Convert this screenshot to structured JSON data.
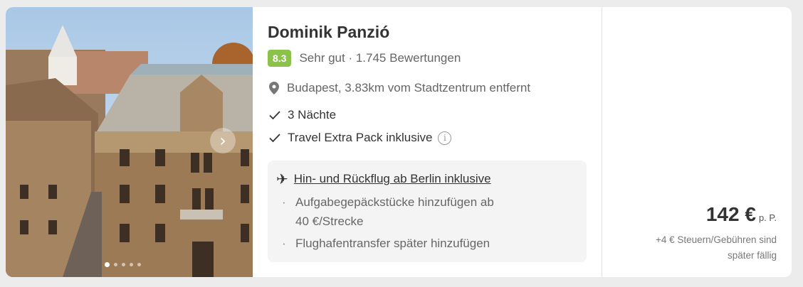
{
  "hotel": {
    "name": "Dominik Panzió",
    "score": "8.3",
    "rating_text": "Sehr gut · 1.745 Bewertungen",
    "location": "Budapest, 3.83km vom Stadtzentrum entfernt",
    "features": [
      "3 Nächte",
      "Travel Extra Pack inklusive"
    ]
  },
  "flight": {
    "title": "Hin- und Rückflug ab Berlin inklusive",
    "bullets": [
      "Aufgabegepäckstücke hinzufügen ab",
      "40 €/Strecke",
      "Flughafentransfer später hinzufügen"
    ]
  },
  "price": {
    "value": "142 €",
    "unit": "p. P.",
    "tax_line1": "+4 € Steuern/Gebühren sind",
    "tax_line2": "später fällig"
  },
  "gallery": {
    "image_count": 5,
    "active_index": 0
  },
  "icons": {
    "location": "map-pin-icon",
    "check": "check-icon",
    "info": "info-icon",
    "plane": "plane-icon",
    "next": "chevron-right-icon"
  },
  "colors": {
    "score_badge": "#8bc34a",
    "card_bg": "#ffffff",
    "page_bg": "#ececec",
    "flight_box": "#f4f4f4"
  }
}
